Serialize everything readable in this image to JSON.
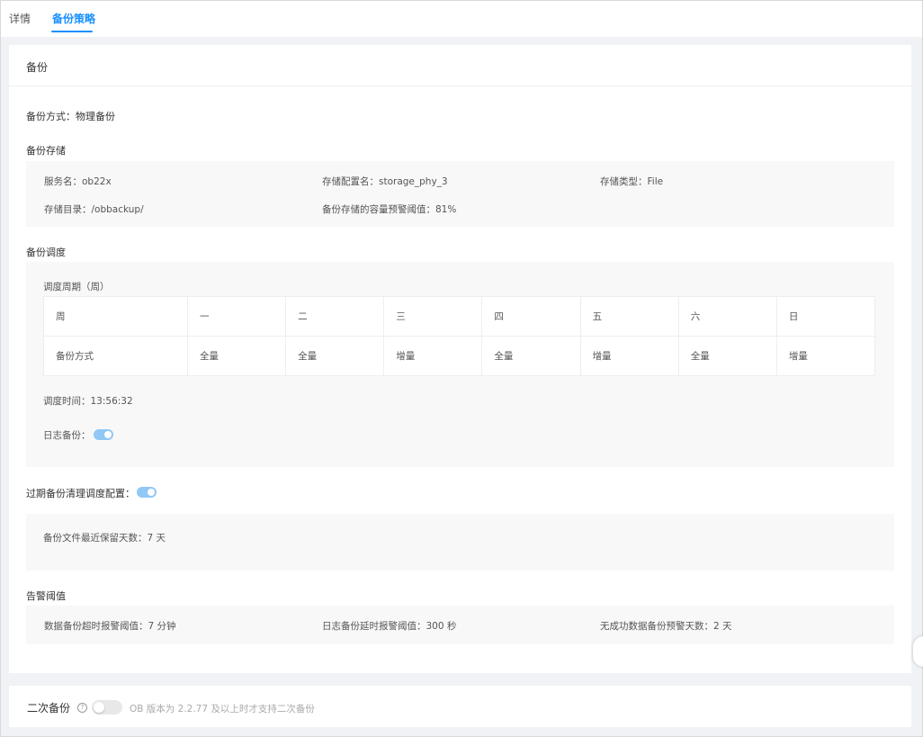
{
  "tabs": [
    {
      "label": "详情"
    },
    {
      "label": "备份策略"
    }
  ],
  "backup": {
    "title": "备份",
    "method": "备份方式：物理备份",
    "storage": {
      "heading": "备份存储",
      "service_name": "服务名：ob22x",
      "config_name": "存储配置名：storage_phy_3",
      "type": "存储类型：File",
      "dir": "存储目录：/obbackup/",
      "threshold": "备份存储的容量预警阈值：81%"
    },
    "schedule": {
      "heading": "备份调度",
      "period_label": "调度周期（周）",
      "header_row": [
        "周",
        "一",
        "二",
        "三",
        "四",
        "五",
        "六",
        "日"
      ],
      "method_row": [
        "备份方式",
        "全量",
        "全量",
        "增量",
        "全量",
        "增量",
        "全量",
        "增量"
      ],
      "time": "调度时间：13:56:32",
      "log_backup_label": "日志备份："
    },
    "cleanup": {
      "label": "过期备份清理调度配置：",
      "retention": "备份文件最近保留天数：7 天"
    },
    "alarm": {
      "heading": "告警阈值",
      "data_timeout": "数据备份超时报警阈值：7 分钟",
      "log_delay": "日志备份延时报警阈值：300 秒",
      "no_success_days": "无成功数据备份预警天数：2 天"
    }
  },
  "secondary": {
    "title": "二次备份",
    "help_glyph": "?",
    "note": "OB 版本为 2.2.77 及以上时才支持二次备份"
  },
  "colors": {
    "accent": "#1890ff",
    "toggle_on": "#91c8f6",
    "panel_bg": "#f8f8f9",
    "page_bg": "#f0f2f5"
  }
}
